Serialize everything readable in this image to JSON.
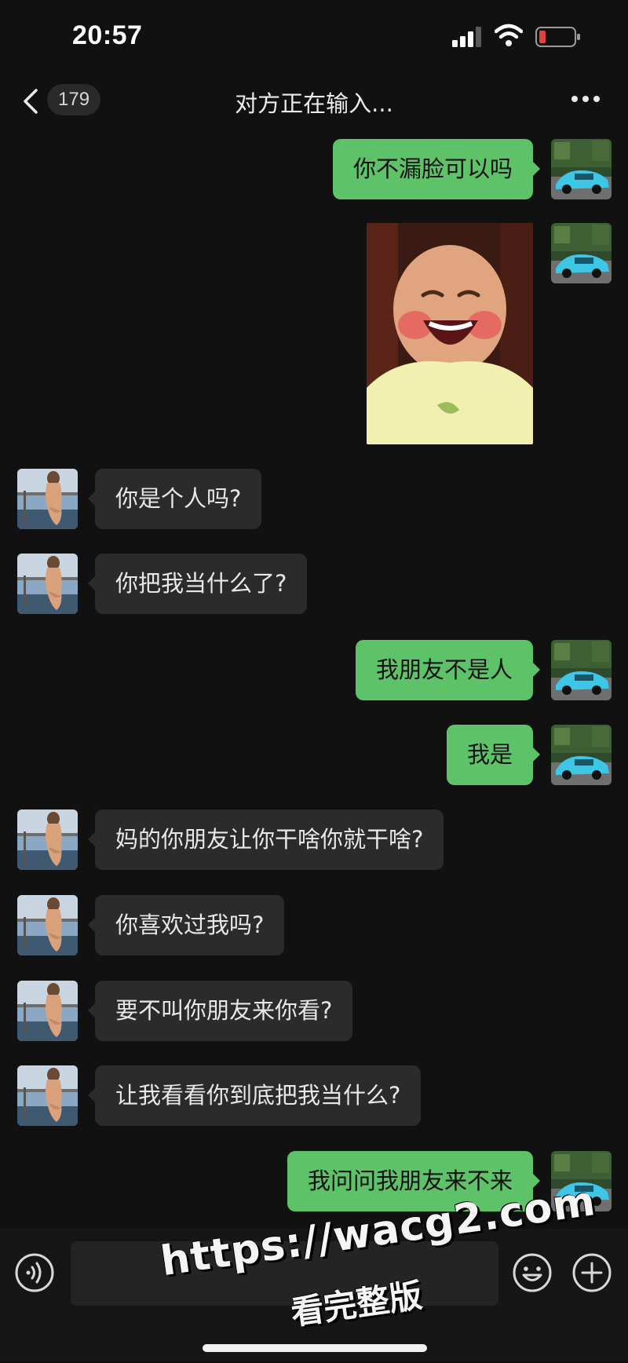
{
  "status_bar": {
    "time": "20:57",
    "icons": [
      "cellular-signal-icon",
      "wifi-icon",
      "battery-low-icon"
    ],
    "battery_color": "#e5413c"
  },
  "nav": {
    "unread_count": "179",
    "title": "对方正在输入...",
    "icons": [
      "back-chevron-icon",
      "more-dots-icon"
    ]
  },
  "colors": {
    "background": "#111111",
    "my_bubble": "#5ec269",
    "their_bubble": "#2b2b2b"
  },
  "messages": [
    {
      "from": "me",
      "type": "text",
      "text": "你不漏脸可以吗"
    },
    {
      "from": "me",
      "type": "sticker",
      "sticker": "laughing-baby-sticker"
    },
    {
      "from": "other",
      "type": "text",
      "text": "你是个人吗?"
    },
    {
      "from": "other",
      "type": "text",
      "text": "你把我当什么了?"
    },
    {
      "from": "me",
      "type": "text",
      "text": "我朋友不是人"
    },
    {
      "from": "me",
      "type": "text",
      "text": "我是"
    },
    {
      "from": "other",
      "type": "text",
      "text": "妈的你朋友让你干啥你就干啥?"
    },
    {
      "from": "other",
      "type": "text",
      "text": "你喜欢过我吗?"
    },
    {
      "from": "other",
      "type": "text",
      "text": "要不叫你朋友来你看?"
    },
    {
      "from": "other",
      "type": "text",
      "text": "让我看看你到底把我当什么?"
    },
    {
      "from": "me",
      "type": "text",
      "text": "我问问我朋友来不来"
    }
  ],
  "input_bar": {
    "value": "",
    "icons": [
      "voice-icon",
      "emoji-icon",
      "plus-icon"
    ]
  },
  "watermark": {
    "line1": "https://wacg2.com",
    "line2": "看完整版"
  }
}
